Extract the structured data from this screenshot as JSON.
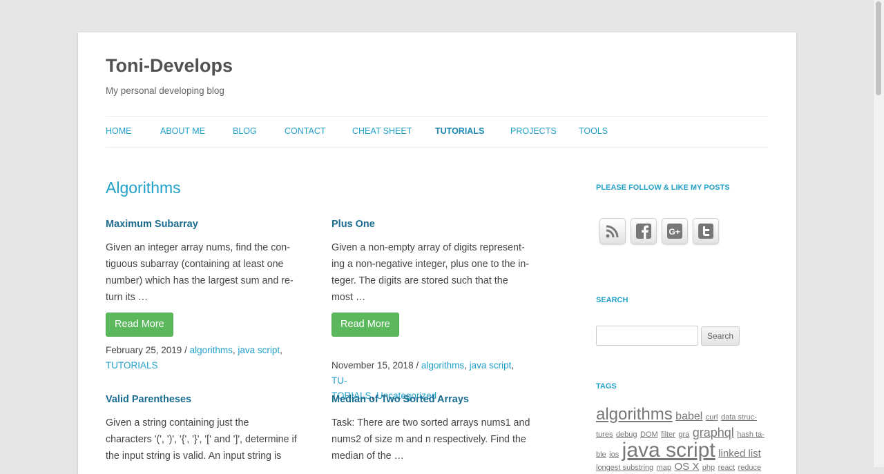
{
  "site": {
    "title": "Toni-Develops",
    "tagline": "My personal developing blog"
  },
  "nav": {
    "items": [
      "HOME",
      "ABOUT ME",
      "BLOG",
      "CONTACT",
      "CHEAT SHEET",
      "TUTORIALS",
      "PROJECTS",
      "TOOLS"
    ],
    "active": "TUTORIALS"
  },
  "archive": {
    "title": "Algorithms"
  },
  "posts": [
    {
      "title": "Maximum Subarray",
      "excerpt": [
        "Given an integer array nums, find the con-",
        "tiguous subarray (containing at least one",
        "number) which has the largest sum and re-",
        "turn its …"
      ],
      "read_more": "Read More",
      "date": "February 25, 2019",
      "categories": [
        "algorithms",
        "java script",
        "TUTORIALS"
      ]
    },
    {
      "title": "Plus One",
      "excerpt": [
        "Given a non-empty array of digits represent-",
        "ing a non-negative integer, plus one to the in-",
        "teger. The digits are stored such that the",
        "most …"
      ],
      "read_more": "Read More",
      "date": "November 15, 2018",
      "categories": [
        "algorithms",
        "java script",
        "TU-\nTORIALS",
        "Uncategorized"
      ]
    },
    {
      "title": "Valid Parentheses",
      "excerpt": [
        "Given a string containing just the",
        "characters '(', ')', '{', '}', '[' and ']', determine if",
        "the input string is valid. An input string is"
      ]
    },
    {
      "title": "Median of Two Sorted Arrays",
      "excerpt": [
        "Task: There are two sorted arrays nums1 and",
        "nums2 of size m and n respectively. Find the",
        "median of the …"
      ]
    }
  ],
  "sidebar": {
    "follow_title": "PLEASE FOLLOW & LIKE MY POSTS",
    "social_icons": [
      "rss-icon",
      "facebook-icon",
      "google-plus-icon",
      "twitter-icon"
    ],
    "search_title": "SEARCH",
    "search_placeholder": "",
    "search_button": "Search",
    "tags_title": "TAGS",
    "tags": [
      {
        "label": "algorithms",
        "size": 24
      },
      {
        "label": "babel",
        "size": 16
      },
      {
        "label": "curl",
        "size": 11
      },
      {
        "label": "data struc-",
        "size": 11
      },
      {
        "label": "tures",
        "size": 11
      },
      {
        "label": "debug",
        "size": 11
      },
      {
        "label": "DOM",
        "size": 11
      },
      {
        "label": "filter",
        "size": 11
      },
      {
        "label": "gra",
        "size": 11
      },
      {
        "label": "graphql",
        "size": 18
      },
      {
        "label": "hash ta-",
        "size": 11
      },
      {
        "label": "ble",
        "size": 11
      },
      {
        "label": "ios",
        "size": 11
      },
      {
        "label": "java script",
        "size": 30
      },
      {
        "label": "linked list",
        "size": 15
      },
      {
        "label": "longest substring",
        "size": 11
      },
      {
        "label": "map",
        "size": 11
      },
      {
        "label": "OS X",
        "size": 15
      },
      {
        "label": "php",
        "size": 11
      },
      {
        "label": "react",
        "size": 11
      },
      {
        "label": "reduce",
        "size": 11
      }
    ]
  },
  "colors": {
    "accent": "#21a0c9",
    "post_title": "#1b6c91",
    "button_green": "#5cb85c",
    "page_bg": "#e6e6e6"
  }
}
